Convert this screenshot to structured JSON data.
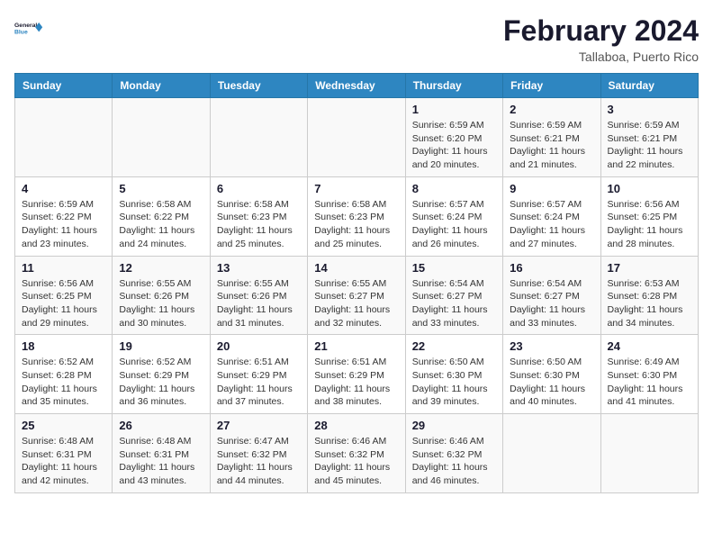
{
  "header": {
    "logo_line1": "General",
    "logo_line2": "Blue",
    "title": "February 2024",
    "subtitle": "Tallaboa, Puerto Rico"
  },
  "weekdays": [
    "Sunday",
    "Monday",
    "Tuesday",
    "Wednesday",
    "Thursday",
    "Friday",
    "Saturday"
  ],
  "weeks": [
    [
      {
        "day": "",
        "info": ""
      },
      {
        "day": "",
        "info": ""
      },
      {
        "day": "",
        "info": ""
      },
      {
        "day": "",
        "info": ""
      },
      {
        "day": "1",
        "info": "Sunrise: 6:59 AM\nSunset: 6:20 PM\nDaylight: 11 hours and 20 minutes."
      },
      {
        "day": "2",
        "info": "Sunrise: 6:59 AM\nSunset: 6:21 PM\nDaylight: 11 hours and 21 minutes."
      },
      {
        "day": "3",
        "info": "Sunrise: 6:59 AM\nSunset: 6:21 PM\nDaylight: 11 hours and 22 minutes."
      }
    ],
    [
      {
        "day": "4",
        "info": "Sunrise: 6:59 AM\nSunset: 6:22 PM\nDaylight: 11 hours and 23 minutes."
      },
      {
        "day": "5",
        "info": "Sunrise: 6:58 AM\nSunset: 6:22 PM\nDaylight: 11 hours and 24 minutes."
      },
      {
        "day": "6",
        "info": "Sunrise: 6:58 AM\nSunset: 6:23 PM\nDaylight: 11 hours and 25 minutes."
      },
      {
        "day": "7",
        "info": "Sunrise: 6:58 AM\nSunset: 6:23 PM\nDaylight: 11 hours and 25 minutes."
      },
      {
        "day": "8",
        "info": "Sunrise: 6:57 AM\nSunset: 6:24 PM\nDaylight: 11 hours and 26 minutes."
      },
      {
        "day": "9",
        "info": "Sunrise: 6:57 AM\nSunset: 6:24 PM\nDaylight: 11 hours and 27 minutes."
      },
      {
        "day": "10",
        "info": "Sunrise: 6:56 AM\nSunset: 6:25 PM\nDaylight: 11 hours and 28 minutes."
      }
    ],
    [
      {
        "day": "11",
        "info": "Sunrise: 6:56 AM\nSunset: 6:25 PM\nDaylight: 11 hours and 29 minutes."
      },
      {
        "day": "12",
        "info": "Sunrise: 6:55 AM\nSunset: 6:26 PM\nDaylight: 11 hours and 30 minutes."
      },
      {
        "day": "13",
        "info": "Sunrise: 6:55 AM\nSunset: 6:26 PM\nDaylight: 11 hours and 31 minutes."
      },
      {
        "day": "14",
        "info": "Sunrise: 6:55 AM\nSunset: 6:27 PM\nDaylight: 11 hours and 32 minutes."
      },
      {
        "day": "15",
        "info": "Sunrise: 6:54 AM\nSunset: 6:27 PM\nDaylight: 11 hours and 33 minutes."
      },
      {
        "day": "16",
        "info": "Sunrise: 6:54 AM\nSunset: 6:27 PM\nDaylight: 11 hours and 33 minutes."
      },
      {
        "day": "17",
        "info": "Sunrise: 6:53 AM\nSunset: 6:28 PM\nDaylight: 11 hours and 34 minutes."
      }
    ],
    [
      {
        "day": "18",
        "info": "Sunrise: 6:52 AM\nSunset: 6:28 PM\nDaylight: 11 hours and 35 minutes."
      },
      {
        "day": "19",
        "info": "Sunrise: 6:52 AM\nSunset: 6:29 PM\nDaylight: 11 hours and 36 minutes."
      },
      {
        "day": "20",
        "info": "Sunrise: 6:51 AM\nSunset: 6:29 PM\nDaylight: 11 hours and 37 minutes."
      },
      {
        "day": "21",
        "info": "Sunrise: 6:51 AM\nSunset: 6:29 PM\nDaylight: 11 hours and 38 minutes."
      },
      {
        "day": "22",
        "info": "Sunrise: 6:50 AM\nSunset: 6:30 PM\nDaylight: 11 hours and 39 minutes."
      },
      {
        "day": "23",
        "info": "Sunrise: 6:50 AM\nSunset: 6:30 PM\nDaylight: 11 hours and 40 minutes."
      },
      {
        "day": "24",
        "info": "Sunrise: 6:49 AM\nSunset: 6:30 PM\nDaylight: 11 hours and 41 minutes."
      }
    ],
    [
      {
        "day": "25",
        "info": "Sunrise: 6:48 AM\nSunset: 6:31 PM\nDaylight: 11 hours and 42 minutes."
      },
      {
        "day": "26",
        "info": "Sunrise: 6:48 AM\nSunset: 6:31 PM\nDaylight: 11 hours and 43 minutes."
      },
      {
        "day": "27",
        "info": "Sunrise: 6:47 AM\nSunset: 6:32 PM\nDaylight: 11 hours and 44 minutes."
      },
      {
        "day": "28",
        "info": "Sunrise: 6:46 AM\nSunset: 6:32 PM\nDaylight: 11 hours and 45 minutes."
      },
      {
        "day": "29",
        "info": "Sunrise: 6:46 AM\nSunset: 6:32 PM\nDaylight: 11 hours and 46 minutes."
      },
      {
        "day": "",
        "info": ""
      },
      {
        "day": "",
        "info": ""
      }
    ]
  ]
}
